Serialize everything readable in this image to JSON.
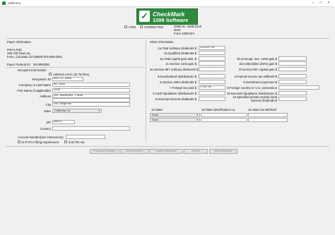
{
  "window": {
    "title": "1099 Ent"
  },
  "logo": {
    "line1": "CheckMark",
    "line2": "1099 Software"
  },
  "form_flags": {
    "void_label": "VOID",
    "corrected_label": "CORRECTED"
  },
  "omb": {
    "line1": "OMB No. 1545-0110",
    "line2": "2024",
    "line3": "Form 1099-DIV"
  },
  "payer": {
    "section_label": "Payer Information",
    "name": "Pete's Pub",
    "address": "205 Old Town Sq",
    "city_line": "Feos, Colorado CO  80529  970-555-0001",
    "fed_id_label": "Payer Federal ID:",
    "fed_id": "00-0000000"
  },
  "recipient": {
    "section_label": "Recipient Information",
    "not_us_label": "Address not in US Territory",
    "id_label": "Recipient's ID",
    "id_value": "000-22-0000",
    "company_label": "Company or Last Name",
    "company_value": "McClane",
    "first_label": "First Name (if applicable)",
    "first_value": "John",
    "address_label": "Address",
    "address_value": "445 Nakatomi Plaza",
    "city_label": "City",
    "city_value": "Los Angeles",
    "state_label": "State",
    "state_value": "California CA",
    "zip_label": "ZIP",
    "zip_value": "90011",
    "country_label": "Country",
    "country_value": "",
    "account_label": "Account Number(see instructions)",
    "account_value": "",
    "fatca_label": "11.FATCA filing requirement",
    "tin_label": "2nd TIN not."
  },
  "other": {
    "section_label": "Other Information",
    "left_fields": [
      {
        "label": "1a.Total ordinary dividends $",
        "value": "150150.00"
      },
      {
        "label": "1b.Qualified dividends $",
        "value": ""
      },
      {
        "label": "2a.Total capital gain distr. $",
        "value": ""
      },
      {
        "label": "2c.Section 1202 gain $",
        "value": ""
      },
      {
        "label": "2e.Section 897 ordinary dividends $",
        "value": ""
      },
      {
        "label": "3.Nondividend distributions $",
        "value": ""
      },
      {
        "label": "5.Section 199A dividends $",
        "value": ""
      },
      {
        "label": "7.Foreign tax paid $",
        "value": "1750.00"
      },
      {
        "label": "9.Cash liquidation distributions $",
        "value": ""
      },
      {
        "label": "12.Exempt-interest dividends $",
        "value": ""
      }
    ],
    "right_fields": [
      {
        "label": "2b.Unrecap. Sec. 1250 gain $",
        "value": ""
      },
      {
        "label": "2d.Collectibles (28%) gain $",
        "value": ""
      },
      {
        "label": "2f.Section 897 capital gain $",
        "value": ""
      },
      {
        "label": "4.Federal income tax withheld $",
        "value": ""
      },
      {
        "label": "6.Investment expenses $",
        "value": ""
      },
      {
        "label": "8.Foreign country or U.S. possession",
        "value": ""
      },
      {
        "label": "10.Noncash liquidation distributions $",
        "value": ""
      },
      {
        "label": "13.Specified private activity bond interest dividends $",
        "value": ""
      }
    ],
    "state_header": "14.State",
    "state_id_header": "15.State identification no.",
    "state_tax_header": "16.State tax withheld",
    "state_rows": [
      {
        "state": "None",
        "id": "",
        "tax": ""
      },
      {
        "state": "None",
        "id": "",
        "tax": ""
      }
    ]
  },
  "buttons": {
    "previous": "Previous Recipient",
    "add": "Add Recipient",
    "update": "Update Recipient",
    "cancel": "Cancel",
    "next": "Next Recipient"
  },
  "colors": {
    "logo_green": "#2e8b3e",
    "background": "#f0f0f0"
  }
}
